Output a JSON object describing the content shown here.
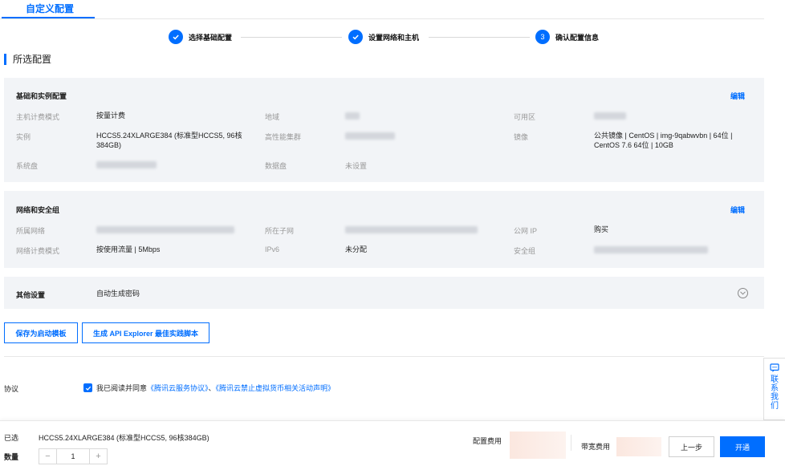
{
  "tab": {
    "title": "自定义配置"
  },
  "steps": [
    {
      "label": "选择基础配置",
      "done": true
    },
    {
      "label": "设置网络和主机",
      "done": true
    },
    {
      "label": "确认配置信息",
      "number": "3"
    }
  ],
  "section_title": "所选配置",
  "basic": {
    "title": "基础和实例配置",
    "edit": "编辑",
    "billing_label": "主机计费模式",
    "billing_value": "按量计费",
    "region_label": "地域",
    "zone_label": "可用区",
    "instance_label": "实例",
    "instance_value": "HCCS5.24XLARGE384 (标准型HCCS5, 96核384GB)",
    "hpc_label": "高性能集群",
    "image_label": "镜像",
    "image_value": "公共镜像 | CentOS | img-9qabwvbn | 64位 | CentOS 7.6 64位 | 10GB",
    "sysdisk_label": "系统盘",
    "datadisk_label": "数据盘",
    "datadisk_value": "未设置"
  },
  "network": {
    "title": "网络和安全组",
    "edit": "编辑",
    "vpc_label": "所属网络",
    "subnet_label": "所在子网",
    "public_ip_label": "公网 IP",
    "public_ip_value": "购买",
    "net_billing_label": "网络计费模式",
    "net_billing_value": "按使用流量 | 5Mbps",
    "ipv6_label": "IPv6",
    "ipv6_value": "未分配",
    "sg_label": "安全组"
  },
  "other": {
    "title": "其他设置",
    "value": "自动生成密码"
  },
  "buttons": {
    "save_template": "保存为启动模板",
    "api_explorer": "生成 API Explorer 最佳实践脚本"
  },
  "agreement": {
    "label": "协议",
    "text": "我已阅读并同意",
    "link1": "《腾讯云服务协议》",
    "sep": "、",
    "link2": "《腾讯云禁止虚拟货币相关活动声明》"
  },
  "contact": {
    "text": "联系我们"
  },
  "footer": {
    "selected_label": "已选",
    "selected_value": "HCCS5.24XLARGE384 (标准型HCCS5, 96核384GB)",
    "qty_label": "数量",
    "qty_minus": "−",
    "qty_value": "1",
    "qty_plus": "+",
    "config_fee_label": "配置费用",
    "bandwidth_fee_label": "带宽费用",
    "prev": "上一步",
    "submit": "开通"
  },
  "colors": {
    "accent": "#006eff",
    "panel_bg": "#f2f4f7"
  }
}
